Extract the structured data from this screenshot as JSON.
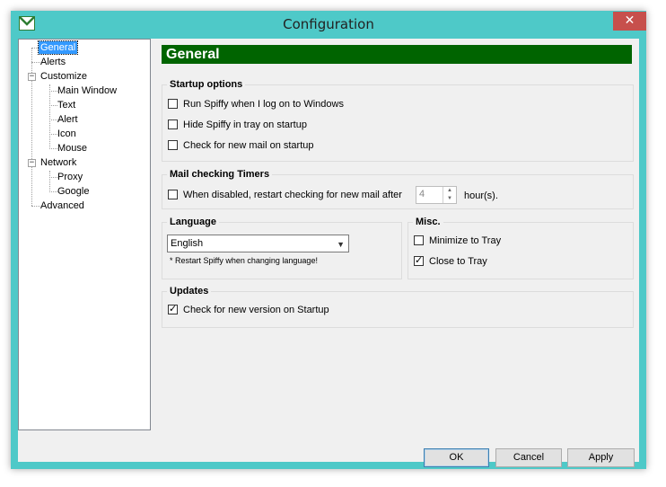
{
  "window": {
    "title": "Configuration",
    "close_glyph": "✕",
    "app_icon": "mail-icon"
  },
  "tree": {
    "items": [
      {
        "label": "General",
        "selected": true
      },
      {
        "label": "Alerts"
      },
      {
        "label": "Customize",
        "expanded": true
      },
      {
        "label": "Main Window"
      },
      {
        "label": "Text"
      },
      {
        "label": "Alert"
      },
      {
        "label": "Icon"
      },
      {
        "label": "Mouse"
      },
      {
        "label": "Network",
        "expanded": true
      },
      {
        "label": "Proxy"
      },
      {
        "label": "Google"
      },
      {
        "label": "Advanced"
      }
    ],
    "expander_glyph": "−"
  },
  "panel": {
    "title": "General",
    "banner_color": "#006400"
  },
  "startup": {
    "title": "Startup options",
    "run_on_logon": {
      "label": "Run Spiffy when I log on to Windows",
      "checked": false
    },
    "hide_in_tray": {
      "label": "Hide Spiffy in tray on startup",
      "checked": false
    },
    "check_mail": {
      "label": "Check for new mail on startup",
      "checked": false
    }
  },
  "timers": {
    "title": "Mail checking Timers",
    "restart": {
      "label": "When disabled, restart checking for new mail after",
      "checked": false
    },
    "hours_value": "4",
    "hours_unit": "hour(s)."
  },
  "language": {
    "title": "Language",
    "selected": "English",
    "note": "* Restart Spiffy when changing language!"
  },
  "misc": {
    "title": "Misc.",
    "minimize": {
      "label": "Minimize to Tray",
      "checked": false
    },
    "close": {
      "label": "Close to Tray",
      "checked": true
    }
  },
  "updates": {
    "title": "Updates",
    "check_version": {
      "label": "Check for new version on Startup",
      "checked": true
    }
  },
  "buttons": {
    "ok": "OK",
    "cancel": "Cancel",
    "apply": "Apply"
  },
  "check_glyph": "✓",
  "colors": {
    "window_frame": "#4ec9c8",
    "close_button": "#c7504c",
    "selection": "#3399ff"
  }
}
